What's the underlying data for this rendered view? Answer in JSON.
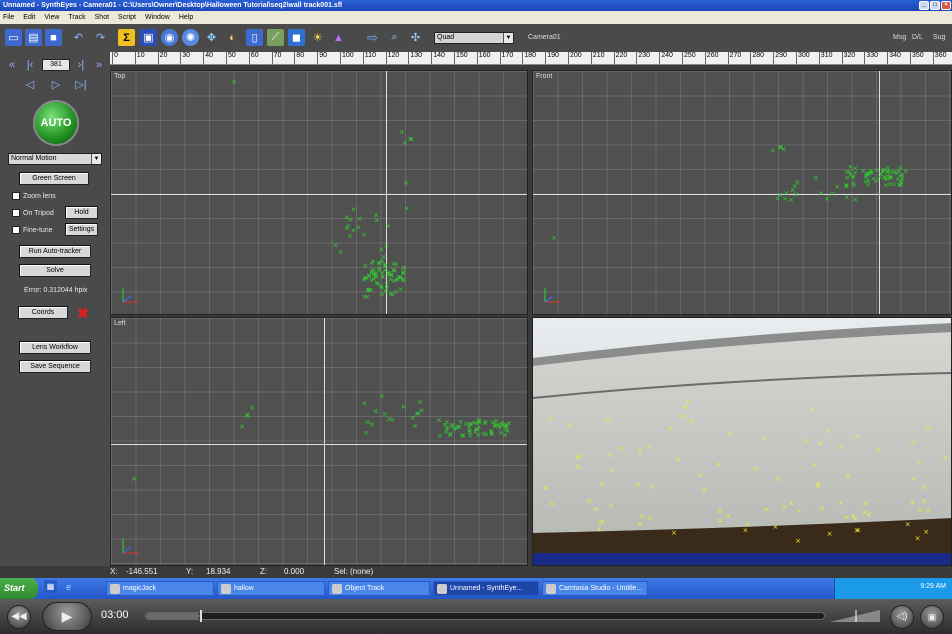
{
  "window": {
    "title": "Unnamed - SynthEyes - Camera01 - C:\\Users\\Owner\\Desktop\\Halloween Tutorial\\seq2\\wall track001.sfl"
  },
  "menu": [
    "File",
    "Edit",
    "View",
    "Track",
    "Shot",
    "Script",
    "Window",
    "Help"
  ],
  "toolbar": {
    "layout_value": "Quad",
    "camera_label": "Camera01",
    "right_labels": [
      "Msg",
      "D/L",
      "Sug"
    ]
  },
  "left_panel": {
    "frame": "381",
    "auto_label": "AUTO",
    "motion_value": "Normal Motion",
    "green_screen": "Green Screen",
    "zoom_lens": "Zoom lens",
    "on_tripod": "On Tripod",
    "hold": "Hold",
    "fine_tune": "Fine-tune",
    "settings": "Settings",
    "run_autotracker": "Run Auto-tracker",
    "solve": "Solve",
    "error": "Error: 0.312044 hpix",
    "coords": "Coords",
    "lens_workflow": "Lens Workflow",
    "save_sequence": "Save Sequence"
  },
  "ruler": [
    "0",
    "10",
    "20",
    "30",
    "40",
    "50",
    "60",
    "70",
    "80",
    "90",
    "100",
    "110",
    "120",
    "130",
    "140",
    "150",
    "160",
    "170",
    "180",
    "190",
    "200",
    "210",
    "220",
    "230",
    "240",
    "250",
    "260",
    "270",
    "280",
    "290",
    "300",
    "310",
    "320",
    "330",
    "340",
    "350",
    "360",
    "370"
  ],
  "viewports": {
    "top": "Top",
    "front": "Front",
    "left": "Left"
  },
  "status": {
    "x_label": "X:",
    "x_value": "-146.551",
    "y_label": "Y:",
    "y_value": "18.934",
    "z_label": "Z:",
    "z_value": "0.000",
    "sel": "Sel: (none)"
  },
  "taskbar": {
    "start": "Start",
    "tasks": [
      "magicJack",
      "hallow",
      "Object Track",
      "Unnamed - SynthEye...",
      "Camtasia Studio - Untitle..."
    ],
    "clock": "9:29 AM"
  },
  "player": {
    "time": "03:00",
    "progress": 0.08
  },
  "colors": {
    "tracker_green": "#2ed82e",
    "tracker_yellow": "#f0f030",
    "viewport_bg": "#505050"
  }
}
